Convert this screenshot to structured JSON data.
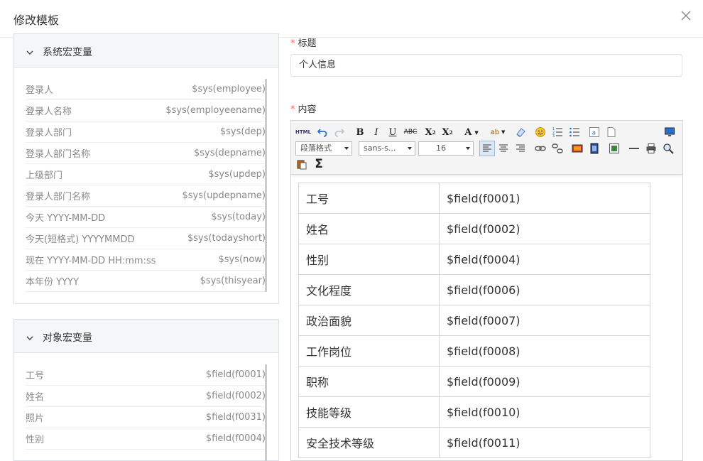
{
  "dialog": {
    "title": "修改模板"
  },
  "system_panel": {
    "title": "系统宏变量",
    "items": [
      {
        "name": "登录人",
        "expr": "$sys(employee)"
      },
      {
        "name": "登录人名称",
        "expr": "$sys(employeename)"
      },
      {
        "name": "登录人部门",
        "expr": "$sys(dep)"
      },
      {
        "name": "登录人部门名称",
        "expr": "$sys(depname)"
      },
      {
        "name": "上级部门",
        "expr": "$sys(updep)"
      },
      {
        "name": "登录人部门名称",
        "expr": "$sys(updepname)"
      },
      {
        "name": "今天 YYYY-MM-DD",
        "expr": "$sys(today)"
      },
      {
        "name": "今天(短格式) YYYYMMDD",
        "expr": "$sys(todayshort)"
      },
      {
        "name": "现在 YYYY-MM-DD HH:mm:ss",
        "expr": "$sys(now)"
      },
      {
        "name": "本年份 YYYY",
        "expr": "$sys(thisyear)"
      }
    ]
  },
  "object_panel": {
    "title": "对象宏变量",
    "items": [
      {
        "name": "工号",
        "expr": "$field(f0001)"
      },
      {
        "name": "姓名",
        "expr": "$field(f0002)"
      },
      {
        "name": "照片",
        "expr": "$field(f0031)"
      },
      {
        "name": "性别",
        "expr": "$field(f0004)"
      }
    ]
  },
  "form": {
    "title_label": "标题",
    "title_value": "个人信息",
    "content_label": "内容",
    "required_mark": "*"
  },
  "editor": {
    "toolbar": {
      "html_label": "HTML",
      "paragraph_format": "段落格式",
      "font_family": "sans-s...",
      "font_size": "16"
    },
    "table_rows": [
      {
        "label": "工号",
        "value": "$field(f0001)"
      },
      {
        "label": "姓名",
        "value": "$field(f0002)"
      },
      {
        "label": "性别",
        "value": "$field(f0004)"
      },
      {
        "label": "文化程度",
        "value": "$field(f0006)"
      },
      {
        "label": "政治面貌",
        "value": "$field(f0007)"
      },
      {
        "label": "工作岗位",
        "value": "$field(f0008)"
      },
      {
        "label": "职称",
        "value": "$field(f0009)"
      },
      {
        "label": "技能等级",
        "value": "$field(f0010)"
      },
      {
        "label": "安全技术等级",
        "value": "$field(f0011)"
      }
    ]
  }
}
